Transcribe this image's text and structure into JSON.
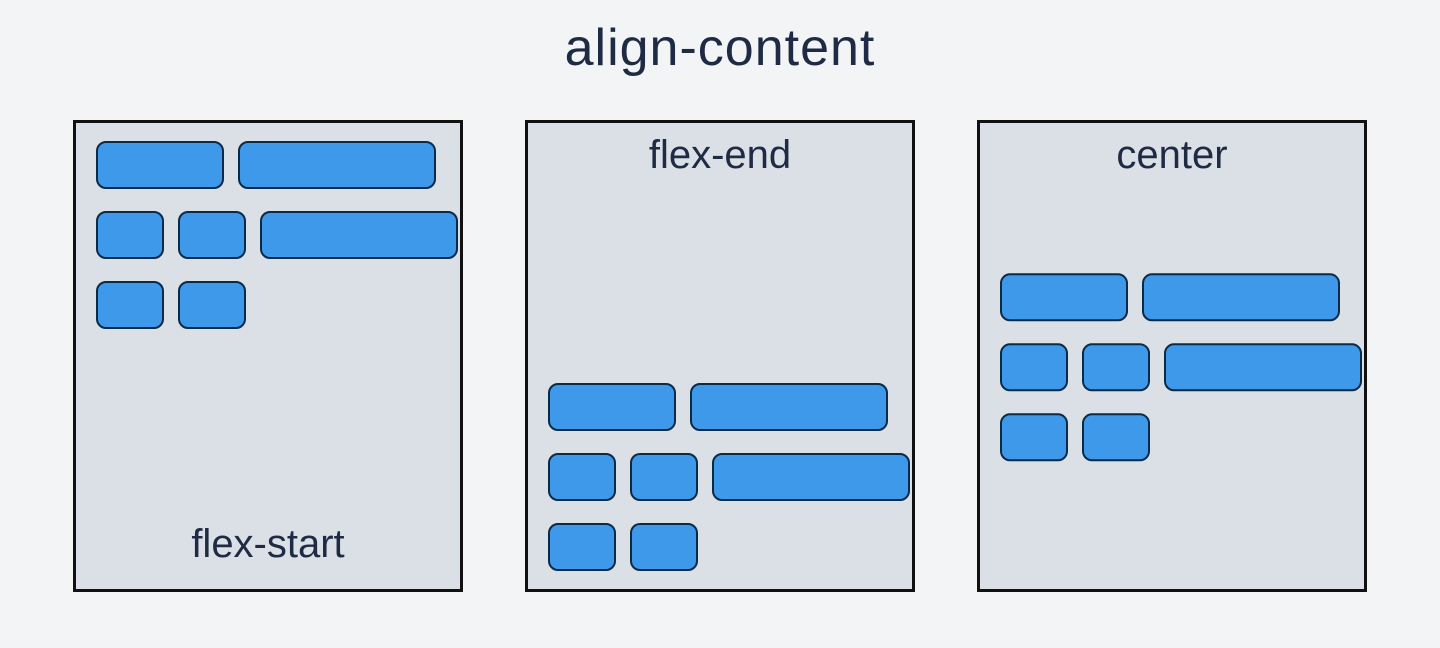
{
  "title": "align-content",
  "panels": {
    "flex_start": {
      "label": "flex-start"
    },
    "flex_end": {
      "label": "flex-end"
    },
    "center": {
      "label": "center"
    }
  },
  "box_sizes": {
    "row1": [
      "md",
      "lg"
    ],
    "row2": [
      "sm",
      "sm",
      "lg"
    ],
    "row3": [
      "sm",
      "sm"
    ]
  },
  "colors": {
    "page_bg": "#f2f4f5",
    "panel_bg": "#dbe0e6",
    "panel_border": "#111111",
    "box_fill": "#3f99ea",
    "box_border": "#0a2b45",
    "text": "#1f2a44"
  }
}
